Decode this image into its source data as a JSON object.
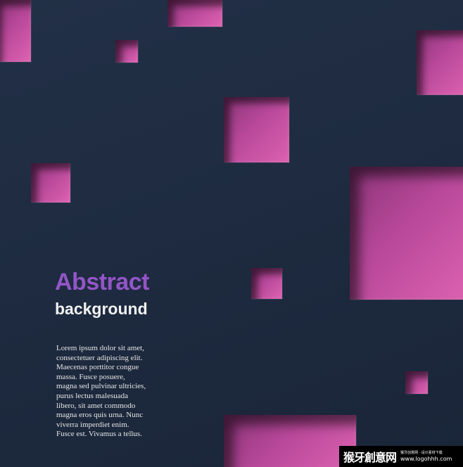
{
  "heading": {
    "title": "Abstract",
    "subtitle": "background"
  },
  "body_lines": [
    "Lorem ipsum dolor sit amet,",
    "consectetuer adipiscing elit.",
    "Maecenas porttitor congue",
    "massa. Fusce posuere,",
    "magna sed pulvinar ultricies,",
    "purus lectus malesuada",
    "libero, sit amet commodo",
    "magna eros quis urna. Nunc",
    "viverra imperdiet enim.",
    "Fusce est. Vivamus a tellus."
  ],
  "watermark": {
    "logo_text": "猴牙創意网",
    "tagline": "猴牙创意网 · 设计素材下载",
    "url": "www.logohhh.com"
  },
  "colors": {
    "background": "#1f2c42",
    "square_fill": "#c24ea3",
    "title": "#9355c6",
    "subtitle": "#f2f2f2"
  }
}
